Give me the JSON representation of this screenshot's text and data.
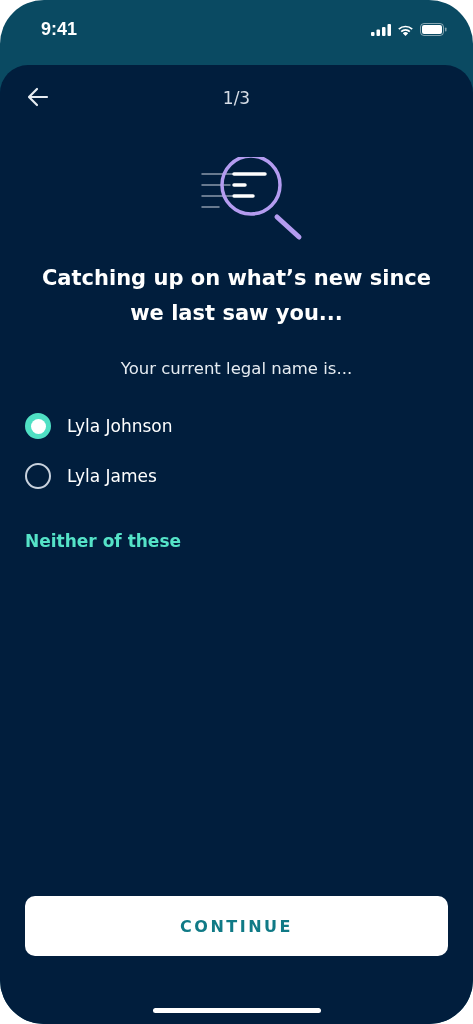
{
  "status_bar": {
    "time": "9:41"
  },
  "nav": {
    "step": "1/3"
  },
  "heading": "Catching up on what’s new since we last saw you...",
  "prompt": "Your current legal name is...",
  "options": [
    {
      "label": "Lyla Johnson",
      "selected": true
    },
    {
      "label": "Lyla James",
      "selected": false
    }
  ],
  "link": "Neither of these",
  "button": "CONTINUE"
}
